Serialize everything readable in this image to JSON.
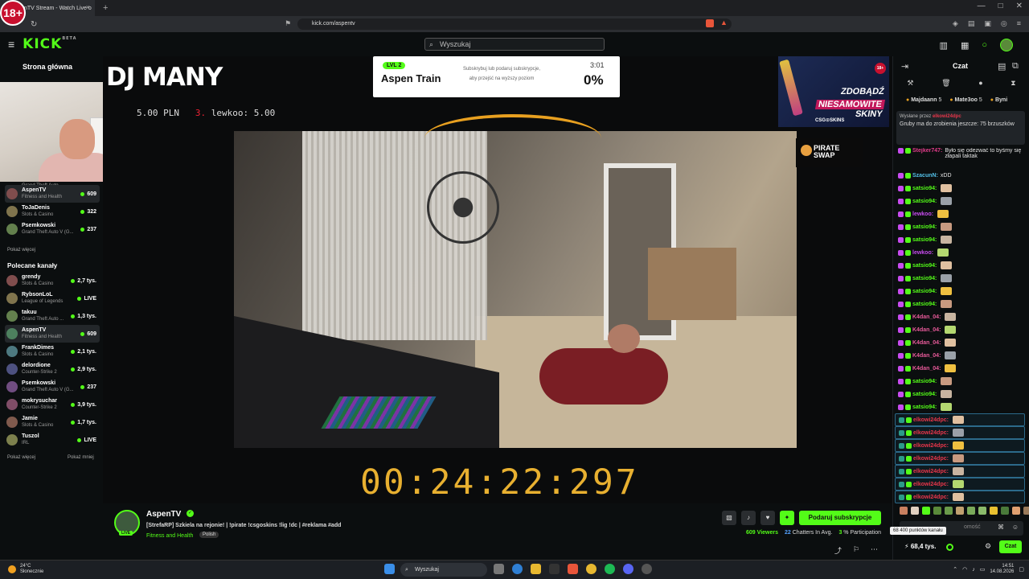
{
  "browser": {
    "age_badge": "18+",
    "tab_title": "nTV Stream - Watch Live o",
    "tab_close": "×",
    "new_tab": "+",
    "url": "kick.com/aspentv",
    "window_controls": [
      "—",
      "□",
      "✕"
    ]
  },
  "header": {
    "logo": "KICK",
    "logo_beta": "BETA",
    "search_placeholder": "Wyszukaj"
  },
  "sidebar": {
    "home": "Strona główna",
    "followed": [
      {
        "name": "AspenTV",
        "category": "Fitness and Health",
        "count": "609",
        "active": true
      },
      {
        "name": "ToJaDenis",
        "category": "Slots & Casino",
        "count": "322"
      },
      {
        "name": "Psemkowski",
        "category": "Grand Theft Auto V (G...",
        "count": "237"
      }
    ],
    "partial_category": "Grand Theft Auto ...",
    "show_more": "Pokaż więcej",
    "recommended_title": "Polecane kanały",
    "recommended": [
      {
        "name": "grendy",
        "category": "Slots & Casino",
        "count": "2,7 tys."
      },
      {
        "name": "RybsonLoL",
        "category": "League of Legends",
        "count": "LIVE"
      },
      {
        "name": "takuu",
        "category": "Grand Theft Auto ...",
        "count": "1,3 tys."
      },
      {
        "name": "AspenTV",
        "category": "Fitness and Health",
        "count": "609",
        "active": true
      },
      {
        "name": "FrankDimes",
        "category": "Slots & Casino",
        "count": "2,1 tys."
      },
      {
        "name": "delordione",
        "category": "Counter-Strike 2",
        "count": "2,9 tys."
      },
      {
        "name": "Psemkowski",
        "category": "Grand Theft Auto V (G...",
        "count": "237"
      },
      {
        "name": "mokrysuchar",
        "category": "Counter-Strike 2",
        "count": "3,9 tys."
      },
      {
        "name": "Jamie",
        "category": "Slots & Casino",
        "count": "1,7 tys."
      },
      {
        "name": "Tuszol",
        "category": "IRL",
        "count": "LIVE"
      }
    ],
    "show_more2": "Pokaż więcej",
    "show_less": "Pokaż mniej"
  },
  "video": {
    "overlay_title": "DJ MANY",
    "ticker_left": "5.00 PLN",
    "ticker_rank": "3.",
    "ticker_right": "lewkoo: 5.00",
    "train": {
      "level": "LVL 2",
      "name": "Aspen Train",
      "desc": "Subskrybuj lub podaruj subskrypcje, aby przejść na wyższy poziom",
      "time": "3:01",
      "percent": "0%"
    },
    "ad": {
      "line1": "ZDOBĄDŹ",
      "line2": "NIESAMOWITE",
      "line3": "SKINY",
      "brand": "CSG⊙SKINS",
      "badge": "18+"
    },
    "sponsor": {
      "line1": "PIRATE",
      "line2": "SWAP"
    },
    "timer": "00:24:22:297"
  },
  "stream_info": {
    "channel": "AspenTV",
    "live": "LIVE",
    "title": "[StrefaRP] Szkiela na rejonie! | !pirate !csgoskins !lig !dc | #reklama #add",
    "category": "Fitness and Health",
    "language": "Polish",
    "subscribe_button": "Podaruj subskrypcje",
    "viewers_count": "609",
    "viewers_label": "Viewers",
    "chatters_count": "22",
    "chatters_label": "Chatters In Avg.",
    "participation_count": "3",
    "participation_label": "% Participation"
  },
  "chat": {
    "title": "Czat",
    "top_gifters": [
      {
        "name": "Majdaann",
        "count": "5"
      },
      {
        "name": "Mate3oo",
        "count": "5"
      },
      {
        "name": "Byni",
        "count": ""
      }
    ],
    "pinned_by": "Wysłane przez",
    "pinned_author": "elkowi24dpc",
    "pinned_text": "Gruby ma do zrobienia jeszcze: 75 brzuszków",
    "messages": [
      {
        "user": "Stejker747",
        "text": "Było się odezwać to byśmy się złapali taktak",
        "color": "#e23c8a"
      },
      {
        "user": "SzacunN",
        "text": "xDD",
        "color": "#53c0e8"
      },
      {
        "user": "satsio94",
        "text": "",
        "color": "#53fc18"
      },
      {
        "user": "satsio94",
        "text": "",
        "color": "#53fc18"
      },
      {
        "user": "lewkoo",
        "text": "",
        "color": "#c84cf0"
      },
      {
        "user": "satsio94",
        "text": "",
        "color": "#53fc18"
      },
      {
        "user": "satsio94",
        "text": "",
        "color": "#53fc18"
      },
      {
        "user": "lewkoo",
        "text": "",
        "color": "#c84cf0"
      },
      {
        "user": "satsio94",
        "text": "",
        "color": "#53fc18"
      },
      {
        "user": "satsio94",
        "text": "",
        "color": "#53fc18"
      },
      {
        "user": "satsio94",
        "text": "",
        "color": "#53fc18"
      },
      {
        "user": "satsio94",
        "text": "",
        "color": "#53fc18"
      },
      {
        "user": "K4dan_04",
        "text": "",
        "color": "#e85a9a"
      },
      {
        "user": "K4dan_04",
        "text": "",
        "color": "#e85a9a"
      },
      {
        "user": "K4dan_04",
        "text": "",
        "color": "#e85a9a"
      },
      {
        "user": "K4dan_04",
        "text": "",
        "color": "#e85a9a"
      },
      {
        "user": "K4dan_04",
        "text": "",
        "color": "#e85a9a"
      },
      {
        "user": "satsio94",
        "text": "",
        "color": "#53fc18"
      },
      {
        "user": "satsio94",
        "text": "",
        "color": "#53fc18"
      },
      {
        "user": "satsio94",
        "text": "",
        "color": "#53fc18"
      },
      {
        "user": "elkowi24dpc",
        "text": "",
        "color": "#e8364a",
        "hl": true
      },
      {
        "user": "elkowi24dpc",
        "text": "",
        "color": "#e8364a",
        "hl": true
      },
      {
        "user": "elkowi24dpc",
        "text": "",
        "color": "#e8364a",
        "hl": true
      },
      {
        "user": "elkowi24dpc",
        "text": "",
        "color": "#e8364a",
        "hl": true
      },
      {
        "user": "elkowi24dpc",
        "text": "",
        "color": "#e8364a",
        "hl": true
      },
      {
        "user": "elkowi24dpc",
        "text": "",
        "color": "#e8364a",
        "hl": true
      },
      {
        "user": "elkowi24dpc",
        "text": "",
        "color": "#e8364a",
        "hl": true
      }
    ],
    "input_placeholder": "omość",
    "tooltip": "68 400 punktów kanału",
    "points": "68,4 tys.",
    "send_button": "Czat"
  },
  "taskbar": {
    "temp": "24°C",
    "weather": "Słonecznie",
    "search": "Wyszukaj",
    "time": "14:51",
    "date": "14.08.2026"
  },
  "colors": {
    "accent": "#53fc18",
    "background": "#0b0e0f"
  }
}
